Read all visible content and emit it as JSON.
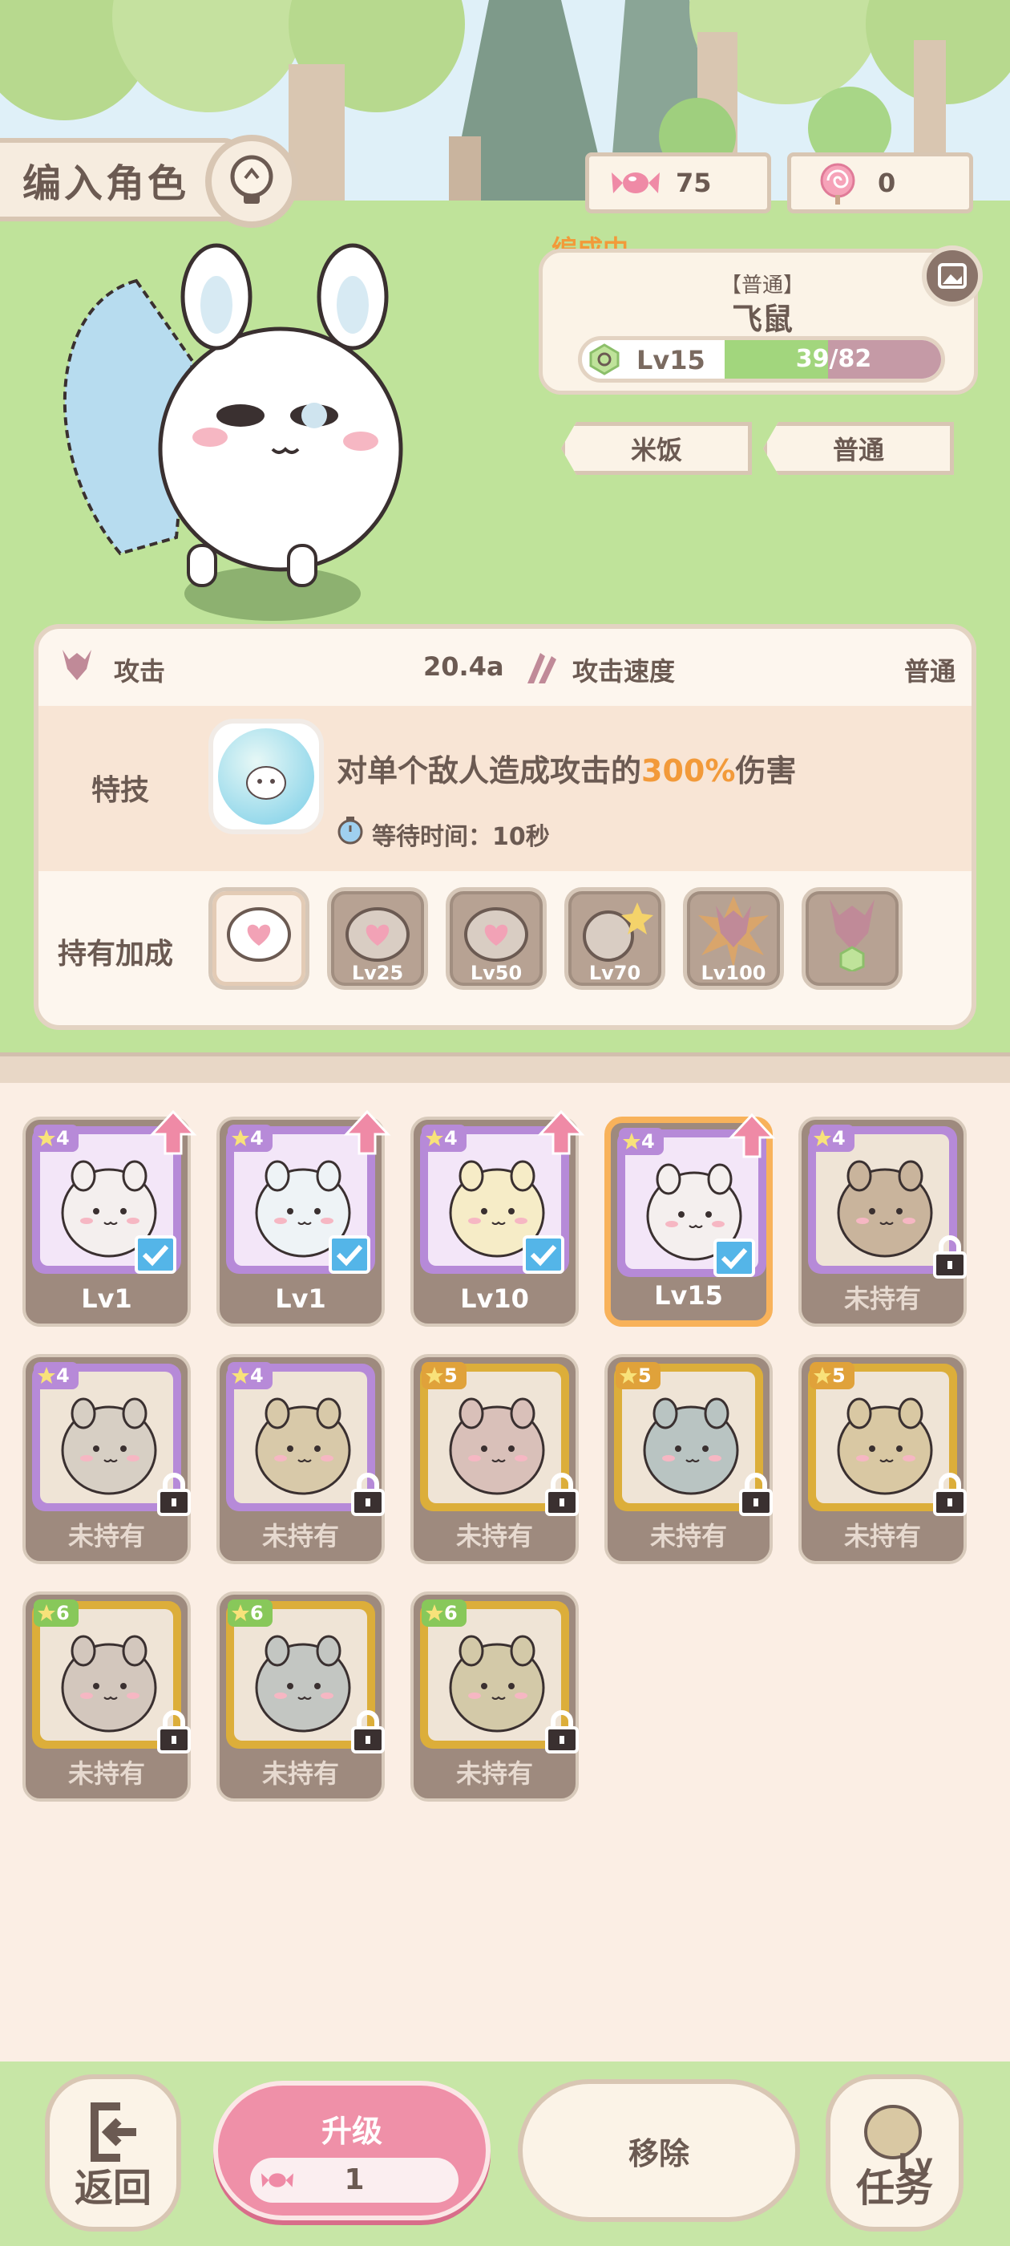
{
  "header": {
    "title": "编入角色",
    "candy_count": "75",
    "lollipop_count": "0"
  },
  "character": {
    "status_label": "编成中",
    "rarity": "【普通】",
    "name": "飞鼠",
    "level": "Lv15",
    "xp_text": "39/82",
    "xp_progress": 0.476,
    "tags": [
      "米饭",
      "普通"
    ]
  },
  "stats": {
    "attack_label": "攻击",
    "attack_value": "20.4a",
    "speed_label": "攻击速度",
    "speed_value": "普通",
    "skill_label": "特技",
    "skill_desc_prefix": "对单个敌人造成攻击的",
    "skill_desc_highlight": "300%",
    "skill_desc_suffix": "伤害",
    "skill_wait": "等待时间：10秒",
    "bonus_label": "持有加成",
    "bonuses": [
      {
        "label": "",
        "icon": "heart-icon",
        "active": true
      },
      {
        "label": "Lv25",
        "icon": "heart-icon",
        "active": false
      },
      {
        "label": "Lv50",
        "icon": "heart-icon",
        "active": false
      },
      {
        "label": "Lv70",
        "icon": "sparkle-icon",
        "active": false
      },
      {
        "label": "Lv100",
        "icon": "attack-burst-icon",
        "active": false
      },
      {
        "label": "",
        "icon": "attack-upgrade-icon",
        "active": false
      }
    ]
  },
  "roster": [
    {
      "stars": "4",
      "footer": "Lv1",
      "owned": true,
      "frame": "purple",
      "art": "#f4efee",
      "upgrade": true,
      "checked": true
    },
    {
      "stars": "4",
      "footer": "Lv1",
      "owned": true,
      "frame": "purple",
      "art": "#eef3f6",
      "upgrade": true,
      "checked": true
    },
    {
      "stars": "4",
      "footer": "Lv10",
      "owned": true,
      "frame": "purple",
      "art": "#f6ecc7",
      "upgrade": true,
      "checked": true
    },
    {
      "stars": "4",
      "footer": "Lv15",
      "owned": true,
      "frame": "purple",
      "art": "#f4efee",
      "upgrade": true,
      "checked": true,
      "selected": true
    },
    {
      "stars": "4",
      "footer": "未持有",
      "owned": false,
      "frame": "purple",
      "art": "#c9b49c"
    },
    {
      "stars": "4",
      "footer": "未持有",
      "owned": false,
      "frame": "purple",
      "art": "#d7cfc4"
    },
    {
      "stars": "4",
      "footer": "未持有",
      "owned": false,
      "frame": "purple",
      "art": "#d8c9a9"
    },
    {
      "stars": "5",
      "footer": "未持有",
      "owned": false,
      "frame": "gold",
      "art": "#d9c0b9"
    },
    {
      "stars": "5",
      "footer": "未持有",
      "owned": false,
      "frame": "gold",
      "art": "#b9c4c2"
    },
    {
      "stars": "5",
      "footer": "未持有",
      "owned": false,
      "frame": "gold",
      "art": "#d9c8a3"
    },
    {
      "stars": "6",
      "footer": "未持有",
      "owned": false,
      "frame": "gold",
      "art": "#d3c7bd"
    },
    {
      "stars": "6",
      "footer": "未持有",
      "owned": false,
      "frame": "gold",
      "art": "#c3c6c2"
    },
    {
      "stars": "6",
      "footer": "未持有",
      "owned": false,
      "frame": "gold",
      "art": "#d3c9a8"
    }
  ],
  "bottom": {
    "back_label": "返回",
    "upgrade_label": "升级",
    "upgrade_cost": "1",
    "remove_label": "移除",
    "task_label": "任务",
    "task_badge": "Lv"
  },
  "colors": {
    "grass": "#bfe39a",
    "accent_orange": "#f29a3a",
    "upgrade_pink": "#ef90a8",
    "check_blue": "#54b5e8",
    "xp_green": "#a2d67d"
  }
}
